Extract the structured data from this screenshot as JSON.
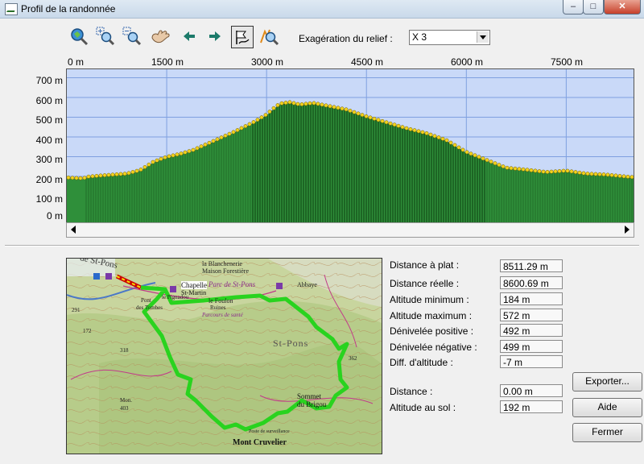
{
  "window": {
    "title": "Profil de la randonnée"
  },
  "titlebar_buttons": {
    "minimize": "–",
    "maximize": "□",
    "close": "✕"
  },
  "toolbar": {
    "tools": [
      {
        "name": "zoom-extent-icon"
      },
      {
        "name": "zoom-in-icon"
      },
      {
        "name": "zoom-out-icon"
      },
      {
        "name": "pan-hand-icon"
      },
      {
        "name": "arrow-left-icon"
      },
      {
        "name": "arrow-right-icon"
      },
      {
        "name": "profile-flag-icon",
        "active": true
      },
      {
        "name": "zoom-custom-icon"
      }
    ],
    "exaggeration_label": "Exagération du relief :",
    "exaggeration_value": "X 3"
  },
  "chart_data": {
    "type": "area",
    "x_tick_labels": [
      "0 m",
      "1500 m",
      "3000 m",
      "4500 m",
      "6000 m",
      "7500 m"
    ],
    "y_tick_labels": [
      "700 m",
      "600 m",
      "500 m",
      "400 m",
      "300 m",
      "200 m",
      "100 m",
      "0 m"
    ],
    "xlim": [
      0,
      8511
    ],
    "ylim": [
      0,
      750
    ],
    "grid": true,
    "colors": {
      "fill": "#2f8f3a",
      "fill_dark": "#0e4012",
      "points": "#f2d21d",
      "background": "#c9d9f8"
    },
    "x": [
      0,
      250,
      300,
      500,
      900,
      1100,
      1300,
      1500,
      1700,
      1900,
      2200,
      2500,
      2800,
      3000,
      3100,
      3200,
      3350,
      3500,
      3700,
      3900,
      4200,
      4500,
      4800,
      5100,
      5400,
      5700,
      6000,
      6300,
      6600,
      6900,
      7200,
      7500,
      7800,
      8100,
      8400,
      8511
    ],
    "values": [
      190,
      186,
      194,
      200,
      210,
      228,
      270,
      295,
      310,
      330,
      375,
      420,
      470,
      510,
      540,
      565,
      572,
      560,
      568,
      555,
      535,
      500,
      470,
      440,
      415,
      380,
      320,
      280,
      240,
      230,
      218,
      225,
      210,
      205,
      195,
      192
    ]
  },
  "map": {
    "labels": {
      "top_left_text": "de St-Pons",
      "farm": "la Blanchenerie",
      "house": "Maison Forestière",
      "chapel": "Chapelle",
      "chapel_sub": "St-Martin",
      "park": "Parc de St-Pons",
      "abbey": "Abbaye",
      "foulon": "le Foulon",
      "ruins": "Ruines",
      "pigne": "le Pignadou",
      "pont": "Pont",
      "tombes": "des Tombes",
      "parcours": "Parcours de santé",
      "stpons": "St-Pons",
      "sommet": "Sommet",
      "brigou": "du Brigou",
      "mont": "Mont Cruvelier",
      "surv": "Poste de surveillance",
      "mon": "Mon.",
      "m403": "403",
      "m172": "172",
      "m318": "318",
      "m362": "362",
      "m291": "291"
    }
  },
  "stats": [
    {
      "label": "Distance à plat :",
      "value": "8511.29 m"
    },
    {
      "label": "Distance réelle :",
      "value": "8600.69 m"
    },
    {
      "label": "Altitude minimum :",
      "value": "184 m"
    },
    {
      "label": "Altitude maximum :",
      "value": "572 m"
    },
    {
      "label": "Dénivelée positive :",
      "value": "492 m"
    },
    {
      "label": "Dénivelée négative :",
      "value": "499 m"
    },
    {
      "label": "Diff. d'altitude :",
      "value": "-7 m"
    }
  ],
  "cursor": [
    {
      "label": "Distance :",
      "value": "0.00 m"
    },
    {
      "label": "Altitude au sol :",
      "value": "192 m"
    }
  ],
  "buttons": {
    "export": "Exporter...",
    "help": "Aide",
    "close": "Fermer"
  }
}
